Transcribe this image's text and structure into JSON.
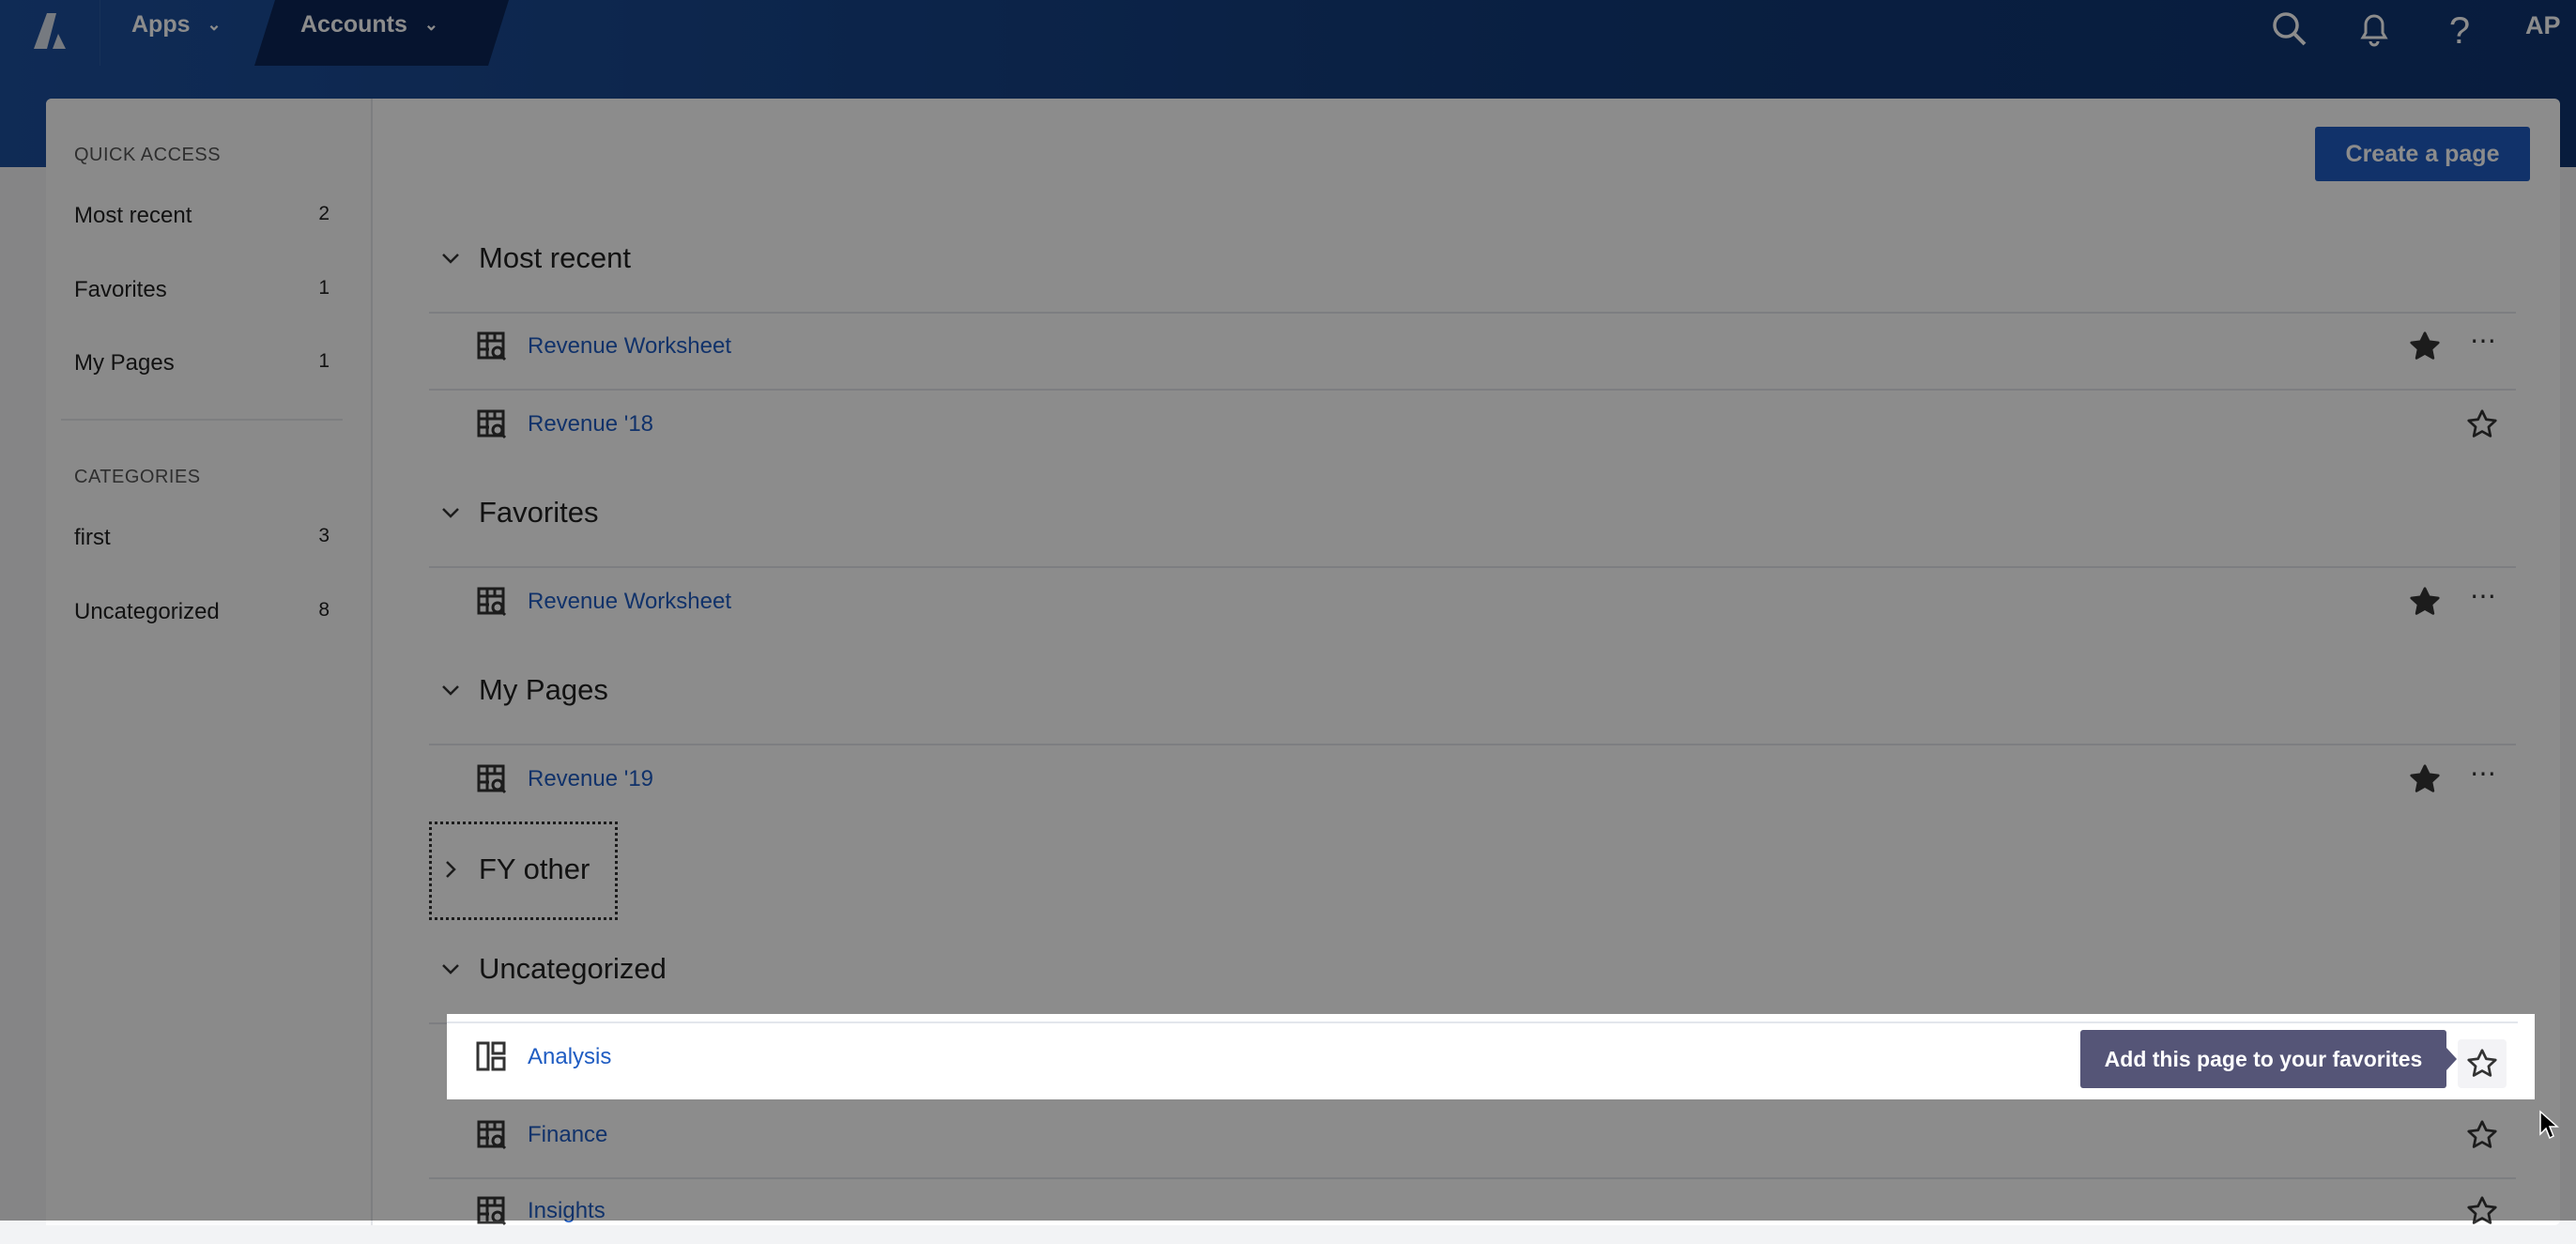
{
  "nav": {
    "apps_label": "Apps",
    "accounts_label": "Accounts",
    "avatar": "AP",
    "icons": [
      "logo",
      "search-icon",
      "bell-icon",
      "help-icon"
    ]
  },
  "sidebar": {
    "quick_access_heading": "QUICK ACCESS",
    "quick_access": [
      {
        "label": "Most recent",
        "count": "2"
      },
      {
        "label": "Favorites",
        "count": "1"
      },
      {
        "label": "My Pages",
        "count": "1"
      }
    ],
    "categories_heading": "CATEGORIES",
    "categories": [
      {
        "label": "first",
        "count": "3"
      },
      {
        "label": "Uncategorized",
        "count": "8"
      }
    ]
  },
  "main": {
    "create_label": "Create a page",
    "sections": [
      {
        "title": "Most recent",
        "expanded": true,
        "rows": [
          {
            "label": "Revenue Worksheet",
            "favorite": true
          },
          {
            "label": "Revenue '18",
            "favorite": false
          }
        ]
      },
      {
        "title": "Favorites",
        "expanded": true,
        "rows": [
          {
            "label": "Revenue Worksheet",
            "favorite": true
          }
        ]
      },
      {
        "title": "My Pages",
        "expanded": true,
        "rows": [
          {
            "label": "Revenue '19",
            "favorite": true
          }
        ]
      },
      {
        "title": "FY other",
        "expanded": false,
        "rows": []
      },
      {
        "title": "Uncategorized",
        "expanded": true,
        "rows": [
          {
            "label": "Analysis",
            "favorite": false
          },
          {
            "label": "Finance",
            "favorite": false
          },
          {
            "label": "Insights",
            "favorite": false
          }
        ]
      }
    ],
    "tooltip": "Add this page to your favorites"
  },
  "colors": {
    "nav": "#1d4f9c",
    "accent": "#1f5cc2",
    "tooltip": "#555577"
  }
}
